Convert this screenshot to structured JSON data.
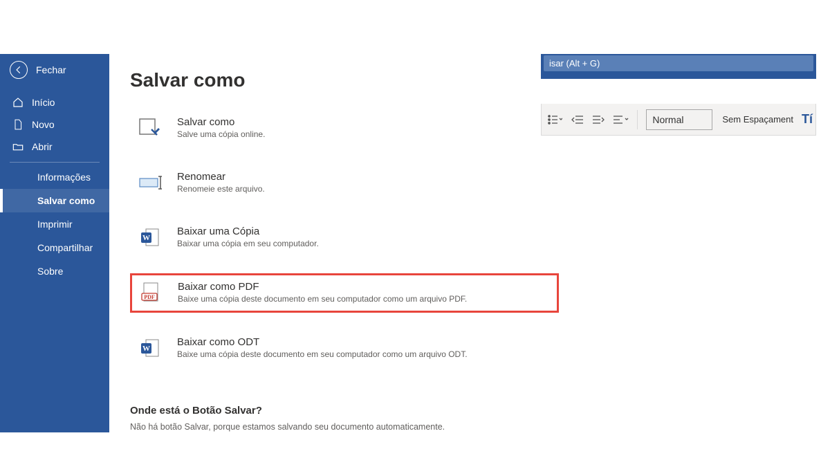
{
  "sidebar": {
    "close_label": "Fechar",
    "nav": [
      {
        "label": "Início"
      },
      {
        "label": "Novo"
      },
      {
        "label": "Abrir"
      }
    ],
    "sub": [
      {
        "label": "Informações"
      },
      {
        "label": "Salvar como"
      },
      {
        "label": "Imprimir"
      },
      {
        "label": "Compartilhar"
      },
      {
        "label": "Sobre"
      }
    ]
  },
  "main": {
    "title": "Salvar como",
    "options": [
      {
        "title": "Salvar como",
        "desc": "Salve uma cópia online."
      },
      {
        "title": "Renomear",
        "desc": "Renomeie este arquivo."
      },
      {
        "title": "Baixar uma Cópia",
        "desc": "Baixar uma cópia em seu computador."
      },
      {
        "title": "Baixar como PDF",
        "desc": "Baixe uma cópia deste documento em seu computador como um arquivo PDF."
      },
      {
        "title": "Baixar como ODT",
        "desc": "Baixe uma cópia deste documento em seu computador como um arquivo ODT."
      }
    ],
    "info_heading": "Onde está o Botão Salvar?",
    "info_body": "Não há botão Salvar, porque estamos salvando seu documento automaticamente."
  },
  "ribbon": {
    "search_placeholder": "isar (Alt + G)",
    "style_normal": "Normal",
    "style_nospacing": "Sem Espaçament",
    "style_t": "Tí"
  }
}
